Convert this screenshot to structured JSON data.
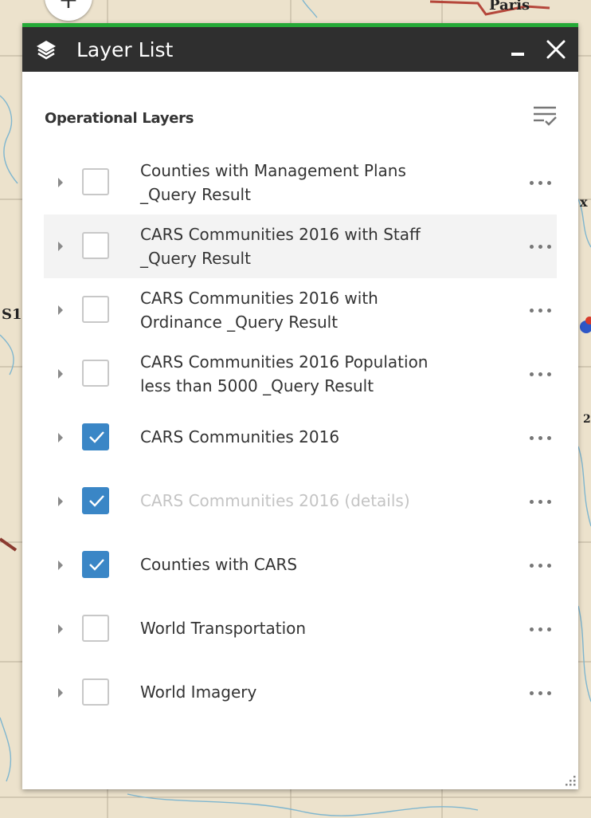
{
  "map": {
    "zoom_in_label": "+",
    "labels": [
      "Paris",
      "x",
      "S1",
      "2"
    ]
  },
  "panel": {
    "title": "Layer List",
    "header_icon": "layers-icon",
    "minimize_icon": "minimize-icon",
    "close_icon": "close-icon",
    "accent_color": "#25a937",
    "header_color": "#2f2f2f"
  },
  "section": {
    "title": "Operational Layers",
    "filter_icon": "filter-list-icon"
  },
  "checkbox_checked_color": "#3a86c6",
  "layers": [
    {
      "label_line1": "Counties with Management Plans",
      "label_line2": "_Query Result",
      "checked": false
    },
    {
      "label_line1": "CARS Communities 2016 with Staff",
      "label_line2": "_Query Result",
      "checked": false
    },
    {
      "label_line1": "CARS Communities 2016 with",
      "label_line2": "Ordinance _Query Result",
      "checked": false
    },
    {
      "label_line1": "CARS Communities 2016 Population",
      "label_line2": "less than 5000 _Query Result",
      "checked": false
    },
    {
      "label": "CARS Communities 2016",
      "checked": true
    },
    {
      "label": "CARS Communities 2016 (details)",
      "checked": true,
      "dimmed": true
    },
    {
      "label": "Counties with CARS",
      "checked": true
    },
    {
      "label": "World Transportation",
      "checked": false
    },
    {
      "label": "World Imagery",
      "checked": false
    }
  ]
}
